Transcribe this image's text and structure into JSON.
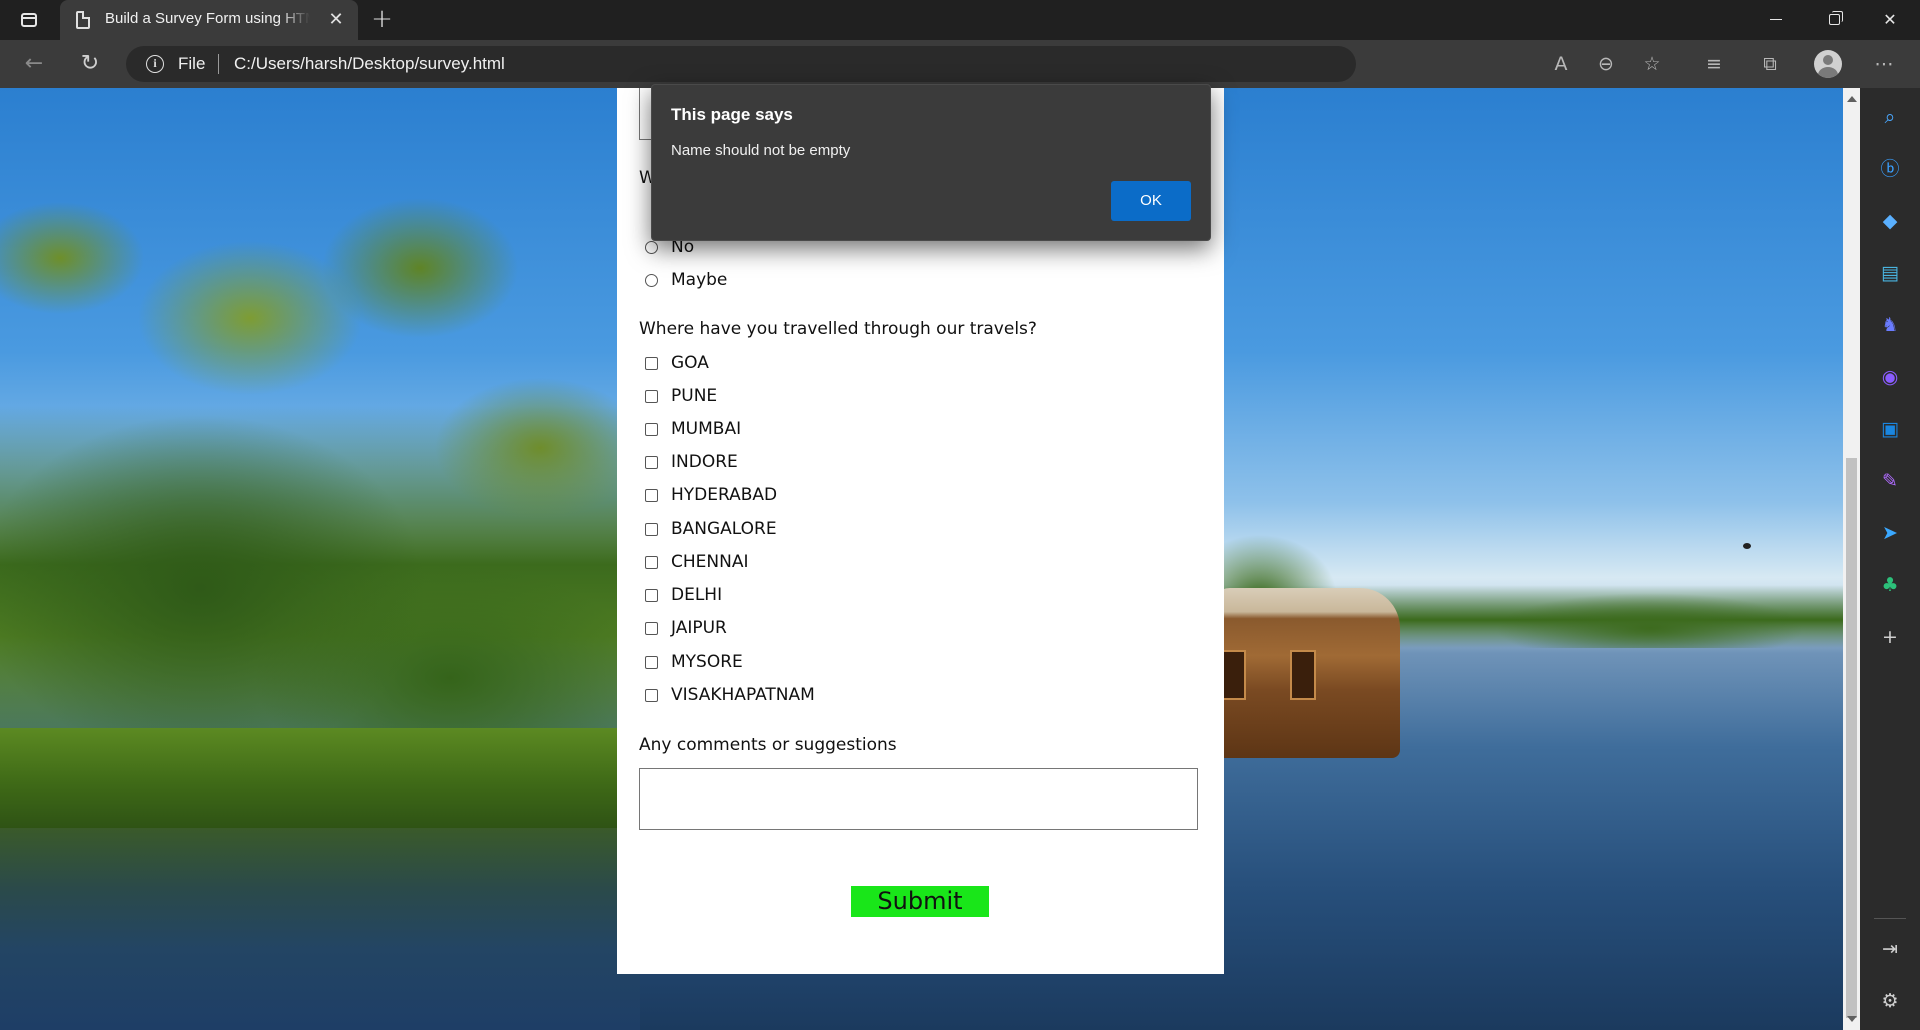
{
  "browser": {
    "tab_title": "Build a Survey Form using HTML",
    "tab_close": "✕",
    "new_tab": "+",
    "address": {
      "scheme_label": "File",
      "url": "C:/Users/harsh/Desktop/survey.html"
    },
    "toolbar_icons": [
      "read-aloud-icon",
      "zoom-out-icon",
      "add-favorite-icon",
      "favorites-icon",
      "collections-icon",
      "profile-avatar",
      "more-options-icon"
    ],
    "window_controls": [
      "minimize",
      "restore",
      "close"
    ]
  },
  "form": {
    "partial_question_char": "W",
    "radio_options": [
      "No",
      "Maybe"
    ],
    "travel_question": "Where have you travelled through our travels?",
    "cities": [
      "GOA",
      "PUNE",
      "MUMBAI",
      "INDORE",
      "HYDERABAD",
      "BANGALORE",
      "CHENNAI",
      "DELHI",
      "JAIPUR",
      "MYSORE",
      "VISAKHAPATNAM"
    ],
    "comments_label": "Any comments or suggestions",
    "comments_value": "",
    "submit_label": "Submit",
    "submit_color": "#19e619"
  },
  "dialog": {
    "title": "This page says",
    "message": "Name should not be empty",
    "ok_label": "OK",
    "ok_color": "#0b6cc8"
  },
  "sidebar": {
    "icons": [
      "search-icon",
      "bing-chat-icon",
      "shopping-tag-icon",
      "tools-icon",
      "games-icon",
      "microsoft-365-icon",
      "outlook-icon",
      "drop-icon",
      "telegram-icon",
      "tree-icon",
      "add-icon",
      "hide-sidebar-icon",
      "settings-icon"
    ]
  }
}
